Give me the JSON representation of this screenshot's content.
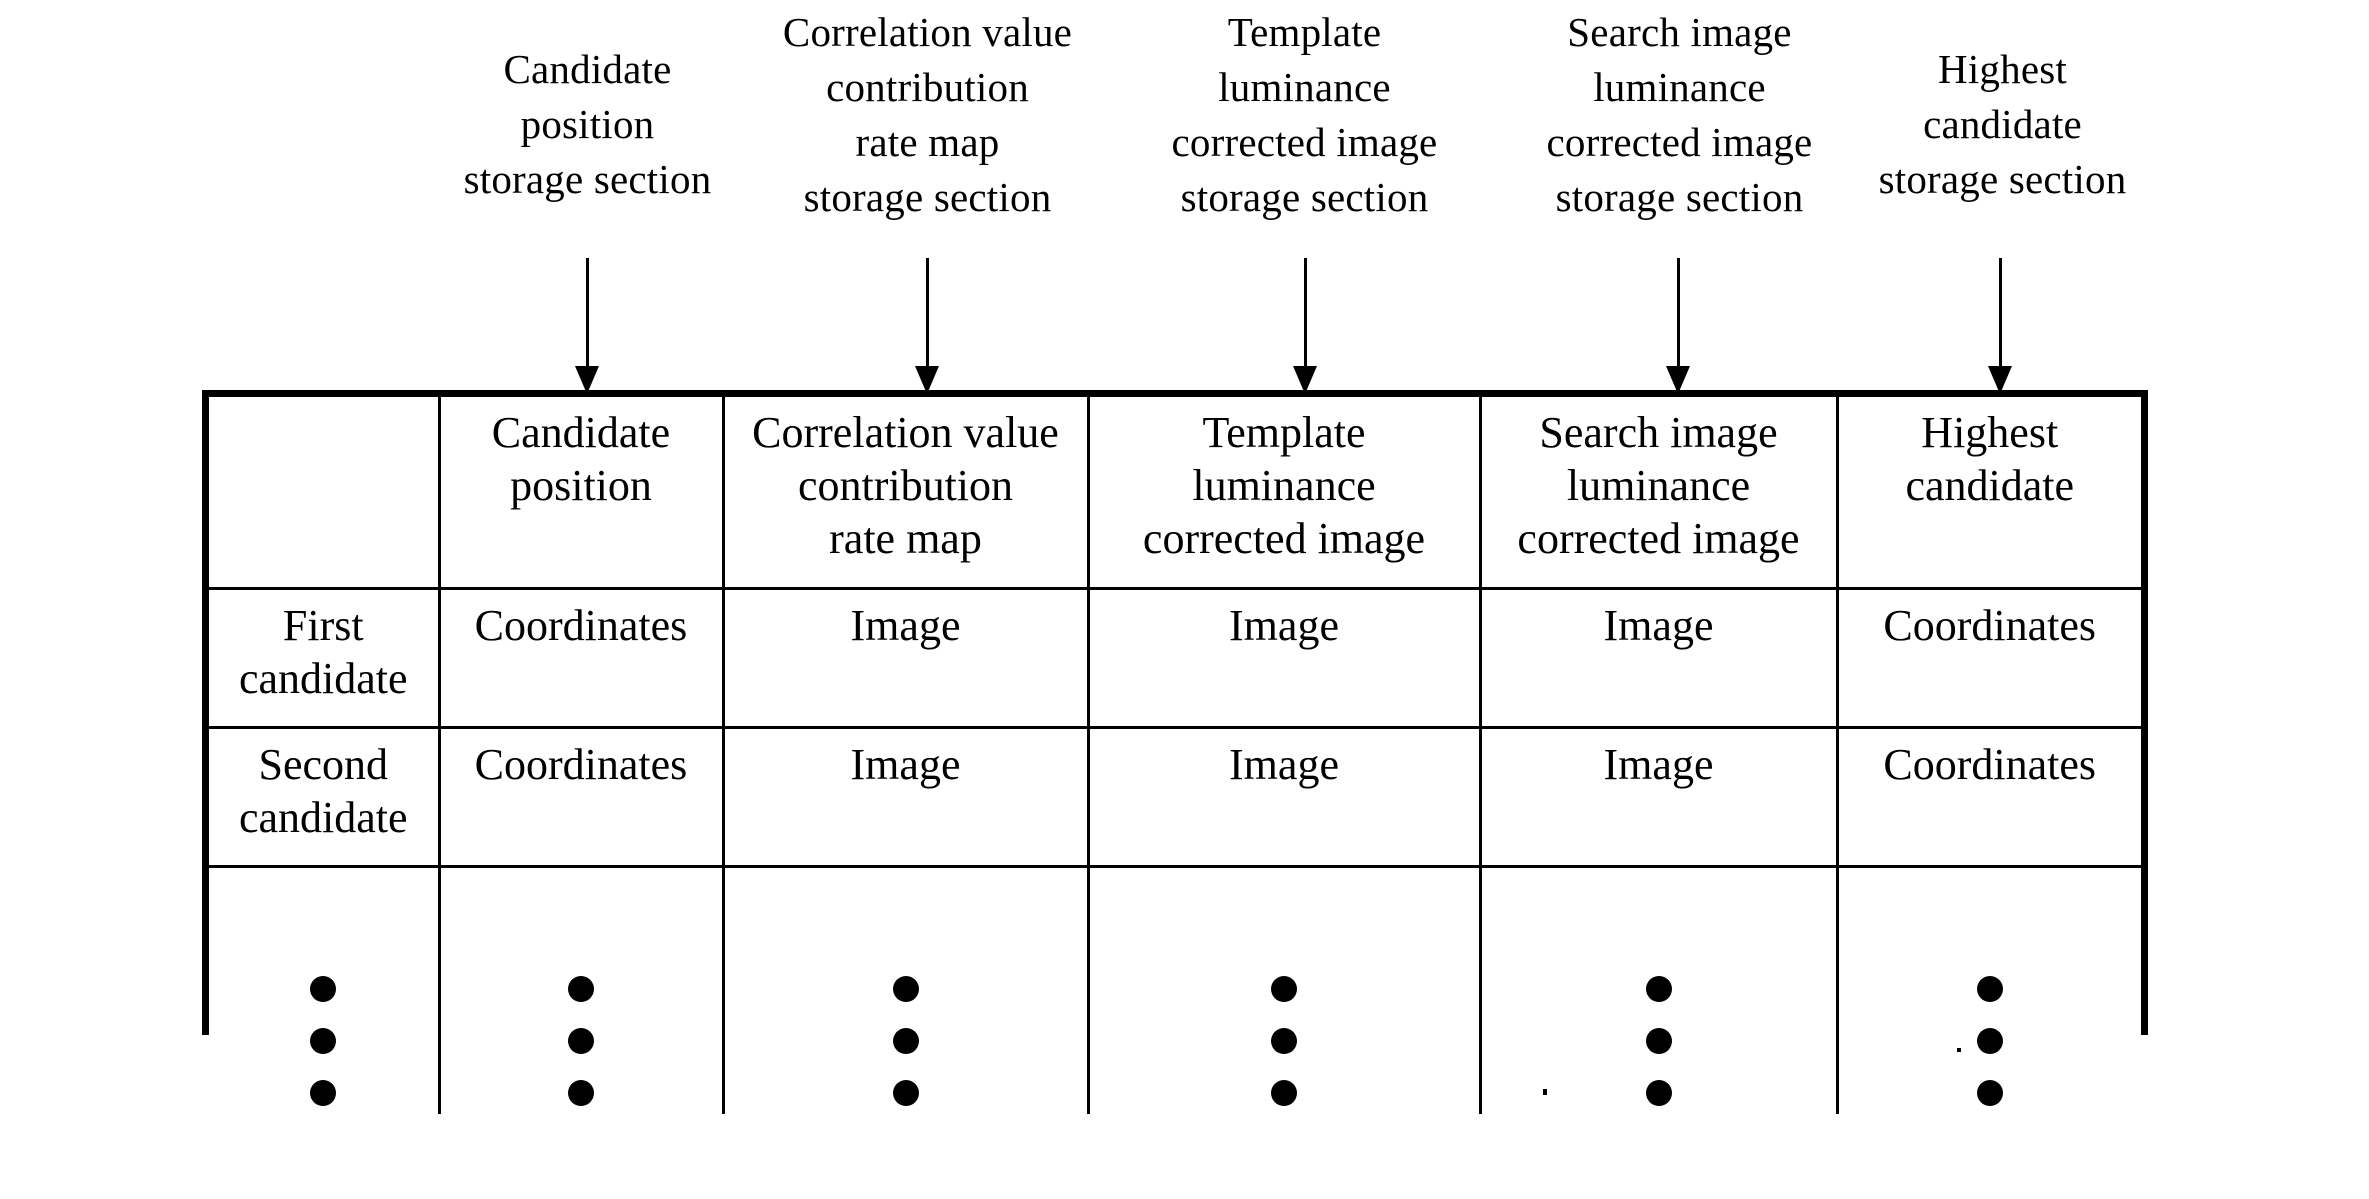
{
  "diagram": {
    "background_color": "#ffffff",
    "ink_color": "#000000",
    "callouts": [
      {
        "id": "candidate-position-storage-section",
        "text": "Candidate\nposition\nstorage section"
      },
      {
        "id": "correlation-value-contribution-rate-map-storage-section",
        "text": "Correlation value\ncontribution\nrate map\nstorage section"
      },
      {
        "id": "template-luminance-corrected-image-storage-section",
        "text": "Template\nluminance\ncorrected image\nstorage section"
      },
      {
        "id": "search-image-luminance-corrected-image-storage-section",
        "text": "Search image\nluminance\ncorrected image\nstorage section"
      },
      {
        "id": "highest-candidate-storage-section",
        "text": "Highest\ncandidate\nstorage section"
      }
    ],
    "arrows": [
      {
        "id": "arrow-to-candidate-position-column"
      },
      {
        "id": "arrow-to-correlation-value-column"
      },
      {
        "id": "arrow-to-template-luminance-column"
      },
      {
        "id": "arrow-to-search-image-luminance-column"
      },
      {
        "id": "arrow-to-highest-candidate-column"
      }
    ],
    "table": {
      "headers": [
        "",
        "Candidate\nposition",
        "Correlation value\ncontribution\nrate map",
        "Template\nluminance\ncorrected image",
        "Search image\nluminance\ncorrected image",
        "Highest\ncandidate"
      ],
      "rows": [
        {
          "label": "First\ncandidate",
          "cells": [
            "Coordinates",
            "Image",
            "Image",
            "Image",
            "Coordinates"
          ]
        },
        {
          "label": "Second\ncandidate",
          "cells": [
            "Coordinates",
            "Image",
            "Image",
            "Image",
            "Coordinates"
          ]
        }
      ],
      "continuation_row": {
        "symbol": "vertical-ellipsis",
        "dot_count": 3,
        "columns": 6
      }
    }
  }
}
